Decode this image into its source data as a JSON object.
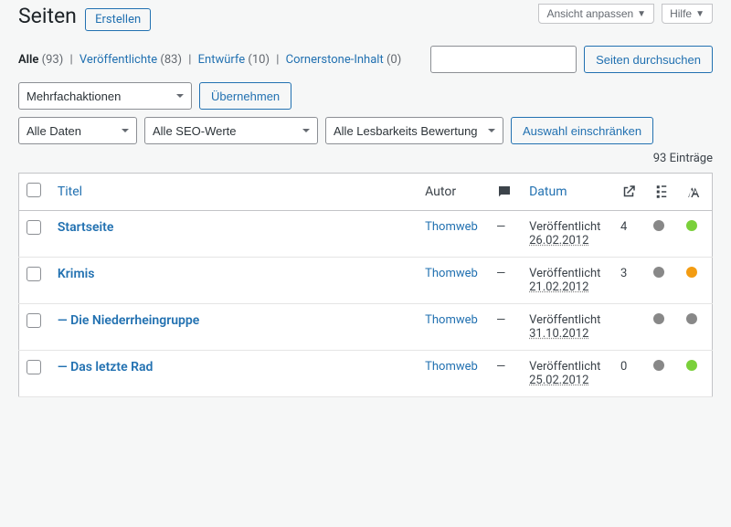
{
  "header": {
    "title": "Seiten",
    "create": "Erstellen",
    "screen_options": "Ansicht anpassen",
    "help": "Hilfe"
  },
  "filters": {
    "all_label": "Alle",
    "all_count": "(93)",
    "published_label": "Veröffentlichte",
    "published_count": "(83)",
    "drafts_label": "Entwürfe",
    "drafts_count": "(10)",
    "cornerstone_label": "Cornerstone-Inhalt",
    "cornerstone_count": "(0)"
  },
  "search": {
    "button": "Seiten durchsuchen"
  },
  "bulk": {
    "actions": "Mehrfachaktionen",
    "apply": "Übernehmen"
  },
  "filter2": {
    "dates": "Alle Daten",
    "seo": "Alle SEO-Werte",
    "readability": "Alle Lesbarkeits Bewertung",
    "filter": "Auswahl einschränken"
  },
  "count": "93 Einträge",
  "columns": {
    "title": "Titel",
    "author": "Autor",
    "date": "Datum"
  },
  "rows": [
    {
      "title": "Startseite",
      "author": "Thomweb",
      "comments": "—",
      "status": "Veröffentlicht",
      "date": "26.02.2012",
      "incoming": "4",
      "seo": "grey",
      "read": "green"
    },
    {
      "title": "Krimis",
      "author": "Thomweb",
      "comments": "—",
      "status": "Veröffentlicht",
      "date": "21.02.2012",
      "incoming": "3",
      "seo": "grey",
      "read": "orange"
    },
    {
      "title": "— Die Niederrheingruppe",
      "author": "Thomweb",
      "comments": "—",
      "status": "Veröffentlicht",
      "date": "31.10.2012",
      "incoming": "",
      "seo": "grey",
      "read": "grey"
    },
    {
      "title": "— Das letzte Rad",
      "author": "Thomweb",
      "comments": "—",
      "status": "Veröffentlicht",
      "date": "25.02.2012",
      "incoming": "0",
      "seo": "grey",
      "read": "green"
    }
  ]
}
